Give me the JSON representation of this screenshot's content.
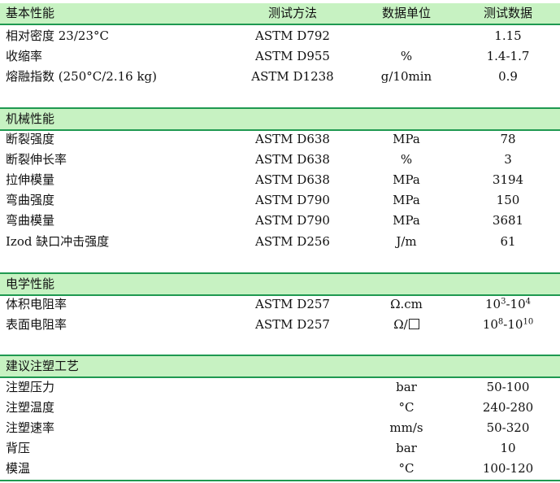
{
  "header": {
    "title": "基本性能",
    "method": "测试方法",
    "unit": "数据单位",
    "value": "测试数据"
  },
  "basic_rows": [
    {
      "name": "相对密度 23/23°C",
      "method": "ASTM D792",
      "unit": "",
      "value": "1.15"
    },
    {
      "name": "收缩率",
      "method": "ASTM D955",
      "unit": "%",
      "value": "1.4-1.7"
    },
    {
      "name": "熔融指数 (250°C/2.16 kg)",
      "method": "ASTM D1238",
      "unit": "g/10min",
      "value": "0.9"
    }
  ],
  "mechanical": {
    "title": "机械性能",
    "rows": [
      {
        "name": "断裂强度",
        "method": "ASTM D638",
        "unit": "MPa",
        "value": "78"
      },
      {
        "name": "断裂伸长率",
        "method": "ASTM D638",
        "unit": "%",
        "value": "3"
      },
      {
        "name": "拉伸模量",
        "method": "ASTM D638",
        "unit": "MPa",
        "value": "3194"
      },
      {
        "name": "弯曲强度",
        "method": "ASTM D790",
        "unit": "MPa",
        "value": "150"
      },
      {
        "name": "弯曲模量",
        "method": "ASTM D790",
        "unit": "MPa",
        "value": "3681"
      },
      {
        "name": "Izod 缺口冲击强度",
        "method": "ASTM D256",
        "unit": "J/m",
        "value": "61"
      }
    ]
  },
  "electrical": {
    "title": "电学性能",
    "rows": [
      {
        "name": "体积电阻率",
        "method": "ASTM D257",
        "unit": "Ω.cm",
        "value_base1": "10",
        "value_exp1": "3",
        "value_sep": "-",
        "value_base2": "10",
        "value_exp2": "4"
      },
      {
        "name": "表面电阻率",
        "method": "ASTM D257",
        "unit": "Ω/",
        "unit_icon": "square-symbol-icon",
        "value_base1": "10",
        "value_exp1": "8",
        "value_sep": "-",
        "value_base2": "10",
        "value_exp2": "10"
      }
    ]
  },
  "process": {
    "title": "建议注塑工艺",
    "rows": [
      {
        "name": "注塑压力",
        "method": "",
        "unit": "bar",
        "value": "50-100"
      },
      {
        "name": "注塑温度",
        "method": "",
        "unit": "°C",
        "value": "240-280"
      },
      {
        "name": "注塑速率",
        "method": "",
        "unit": "mm/s",
        "value": "50-320"
      },
      {
        "name": "背压",
        "method": "",
        "unit": "bar",
        "value": "10"
      },
      {
        "name": "模温",
        "method": "",
        "unit": "°C",
        "value": "100-120"
      }
    ]
  },
  "colors": {
    "header_bg": "#c7f2c2",
    "rule": "#1f9950"
  }
}
